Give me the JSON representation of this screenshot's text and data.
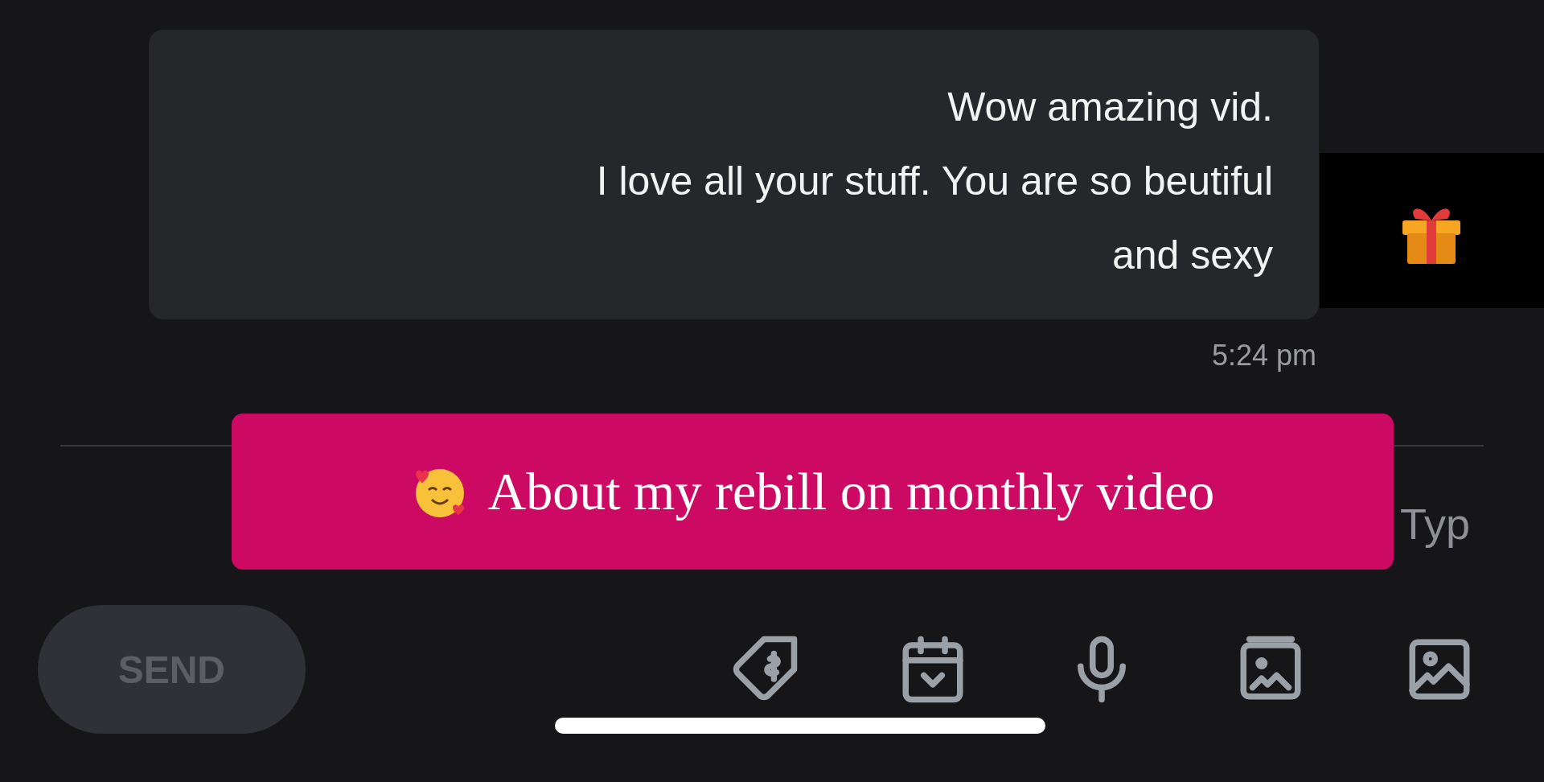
{
  "message": {
    "lines": [
      "Wow amazing vid.",
      "I love all your stuff. You are so beutiful",
      "and sexy"
    ],
    "time": "5:24 pm"
  },
  "composer": {
    "placeholder": "Typ",
    "send": "SEND",
    "send_disabled": true
  },
  "toolbar": [
    {
      "kind": "image"
    },
    {
      "kind": "gallery"
    },
    {
      "kind": "mic"
    },
    {
      "kind": "calendar"
    },
    {
      "kind": "tag"
    }
  ],
  "caption": {
    "text": "About my rebill on monthly video"
  }
}
